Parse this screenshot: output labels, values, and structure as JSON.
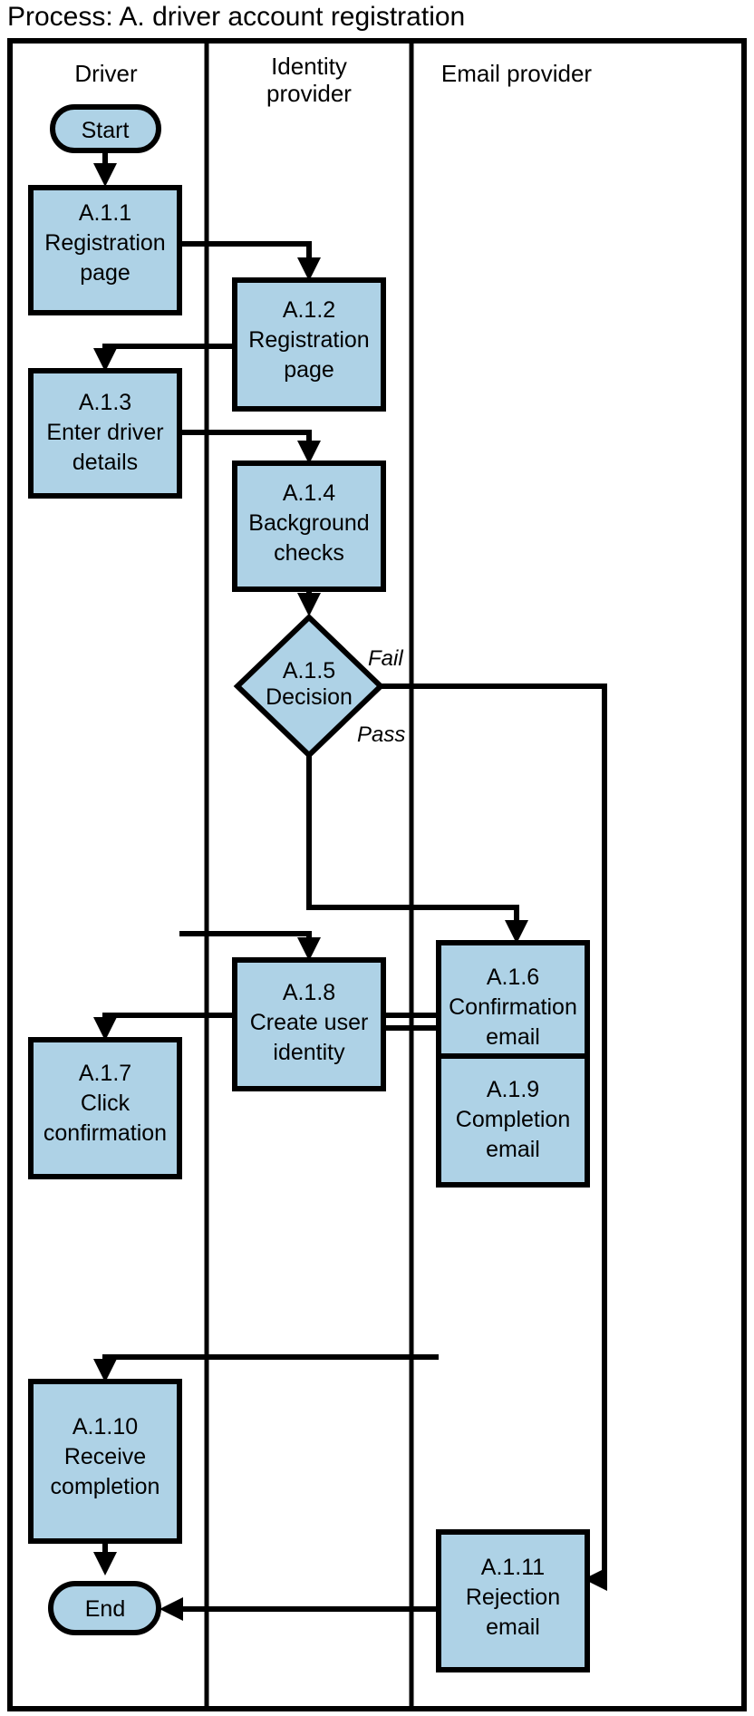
{
  "title": "Process: A. driver account registration",
  "colors": {
    "node_fill": "#aed2e6",
    "stroke": "#000000",
    "background": "#ffffff"
  },
  "lanes": [
    {
      "id": "driver",
      "label": "Driver"
    },
    {
      "id": "identity-provider",
      "label": "Identity\nprovider",
      "label_line1": "Identity",
      "label_line2": "provider"
    },
    {
      "id": "email-provider",
      "label": "Email provider"
    }
  ],
  "nodes": [
    {
      "id": "start",
      "type": "terminator",
      "lane": "driver",
      "label": "Start",
      "lines": [
        "Start"
      ]
    },
    {
      "id": "a111",
      "type": "process",
      "lane": "driver",
      "code": "A.1.1",
      "name": "Registration page",
      "lines": [
        "A.1.1",
        "Registration",
        "page"
      ]
    },
    {
      "id": "a112",
      "type": "process",
      "lane": "identity-provider",
      "code": "A.1.2",
      "name": "Registration page",
      "lines": [
        "A.1.2",
        "Registration",
        "page"
      ]
    },
    {
      "id": "a113",
      "type": "process",
      "lane": "driver",
      "code": "A.1.3",
      "name": "Enter driver details",
      "lines": [
        "A.1.3",
        "Enter driver",
        "details"
      ]
    },
    {
      "id": "a114",
      "type": "process",
      "lane": "identity-provider",
      "code": "A.1.4",
      "name": "Background checks",
      "lines": [
        "A.1.4",
        "Background",
        "checks"
      ]
    },
    {
      "id": "a115",
      "type": "decision",
      "lane": "identity-provider",
      "code": "A.1.5",
      "name": "Decision",
      "lines": [
        "A.1.5",
        "Decision"
      ]
    },
    {
      "id": "a116",
      "type": "process",
      "lane": "email-provider",
      "code": "A.1.6",
      "name": "Confirmation email",
      "lines": [
        "A.1.6",
        "Confirmation",
        "email"
      ]
    },
    {
      "id": "a117",
      "type": "process",
      "lane": "driver",
      "code": "A.1.7",
      "name": "Click confirmation",
      "lines": [
        "A.1.7",
        "Click",
        "confirmation"
      ]
    },
    {
      "id": "a118",
      "type": "process",
      "lane": "identity-provider",
      "code": "A.1.8",
      "name": "Create user identity",
      "lines": [
        "A.1.8",
        "Create user",
        "identity"
      ]
    },
    {
      "id": "a119",
      "type": "process",
      "lane": "email-provider",
      "code": "A.1.9",
      "name": "Completion email",
      "lines": [
        "A.1.9",
        "Completion",
        "email"
      ]
    },
    {
      "id": "a1110",
      "type": "process",
      "lane": "driver",
      "code": "A.1.10",
      "name": "Receive completion",
      "lines": [
        "A.1.10",
        "Receive",
        "completion"
      ]
    },
    {
      "id": "a1111",
      "type": "process",
      "lane": "email-provider",
      "code": "A.1.11",
      "name": "Rejection email",
      "lines": [
        "A.1.11",
        "Rejection",
        "email"
      ]
    },
    {
      "id": "end",
      "type": "terminator",
      "lane": "driver",
      "label": "End",
      "lines": [
        "End"
      ]
    }
  ],
  "edges": [
    {
      "from": "start",
      "to": "a111",
      "label": ""
    },
    {
      "from": "a111",
      "to": "a112",
      "label": ""
    },
    {
      "from": "a112",
      "to": "a113",
      "label": ""
    },
    {
      "from": "a113",
      "to": "a114",
      "label": ""
    },
    {
      "from": "a114",
      "to": "a115",
      "label": ""
    },
    {
      "from": "a115",
      "to": "a1111",
      "label": "Fail"
    },
    {
      "from": "a115",
      "to": "a116",
      "label": "Pass"
    },
    {
      "from": "a116",
      "to": "a117",
      "label": ""
    },
    {
      "from": "a117",
      "to": "a118",
      "label": ""
    },
    {
      "from": "a118",
      "to": "a119",
      "label": ""
    },
    {
      "from": "a119",
      "to": "a1110",
      "label": ""
    },
    {
      "from": "a1110",
      "to": "end",
      "label": ""
    },
    {
      "from": "a1111",
      "to": "end",
      "label": ""
    }
  ],
  "edge_labels": {
    "fail": "Fail",
    "pass": "Pass"
  },
  "node_text": {
    "start": {
      "l1": "Start"
    },
    "a111": {
      "l1": "A.1.1",
      "l2": "Registration",
      "l3": "page"
    },
    "a112": {
      "l1": "A.1.2",
      "l2": "Registration",
      "l3": "page"
    },
    "a113": {
      "l1": "A.1.3",
      "l2": "Enter driver",
      "l3": "details"
    },
    "a114": {
      "l1": "A.1.4",
      "l2": "Background",
      "l3": "checks"
    },
    "a115": {
      "l1": "A.1.5",
      "l2": "Decision"
    },
    "a116": {
      "l1": "A.1.6",
      "l2": "Confirmation",
      "l3": "email"
    },
    "a117": {
      "l1": "A.1.7",
      "l2": "Click",
      "l3": "confirmation"
    },
    "a118": {
      "l1": "A.1.8",
      "l2": "Create user",
      "l3": "identity"
    },
    "a119": {
      "l1": "A.1.9",
      "l2": "Completion",
      "l3": "email"
    },
    "a1110": {
      "l1": "A.1.10",
      "l2": "Receive",
      "l3": "completion"
    },
    "a1111": {
      "l1": "A.1.11",
      "l2": "Rejection",
      "l3": "email"
    },
    "end": {
      "l1": "End"
    }
  }
}
